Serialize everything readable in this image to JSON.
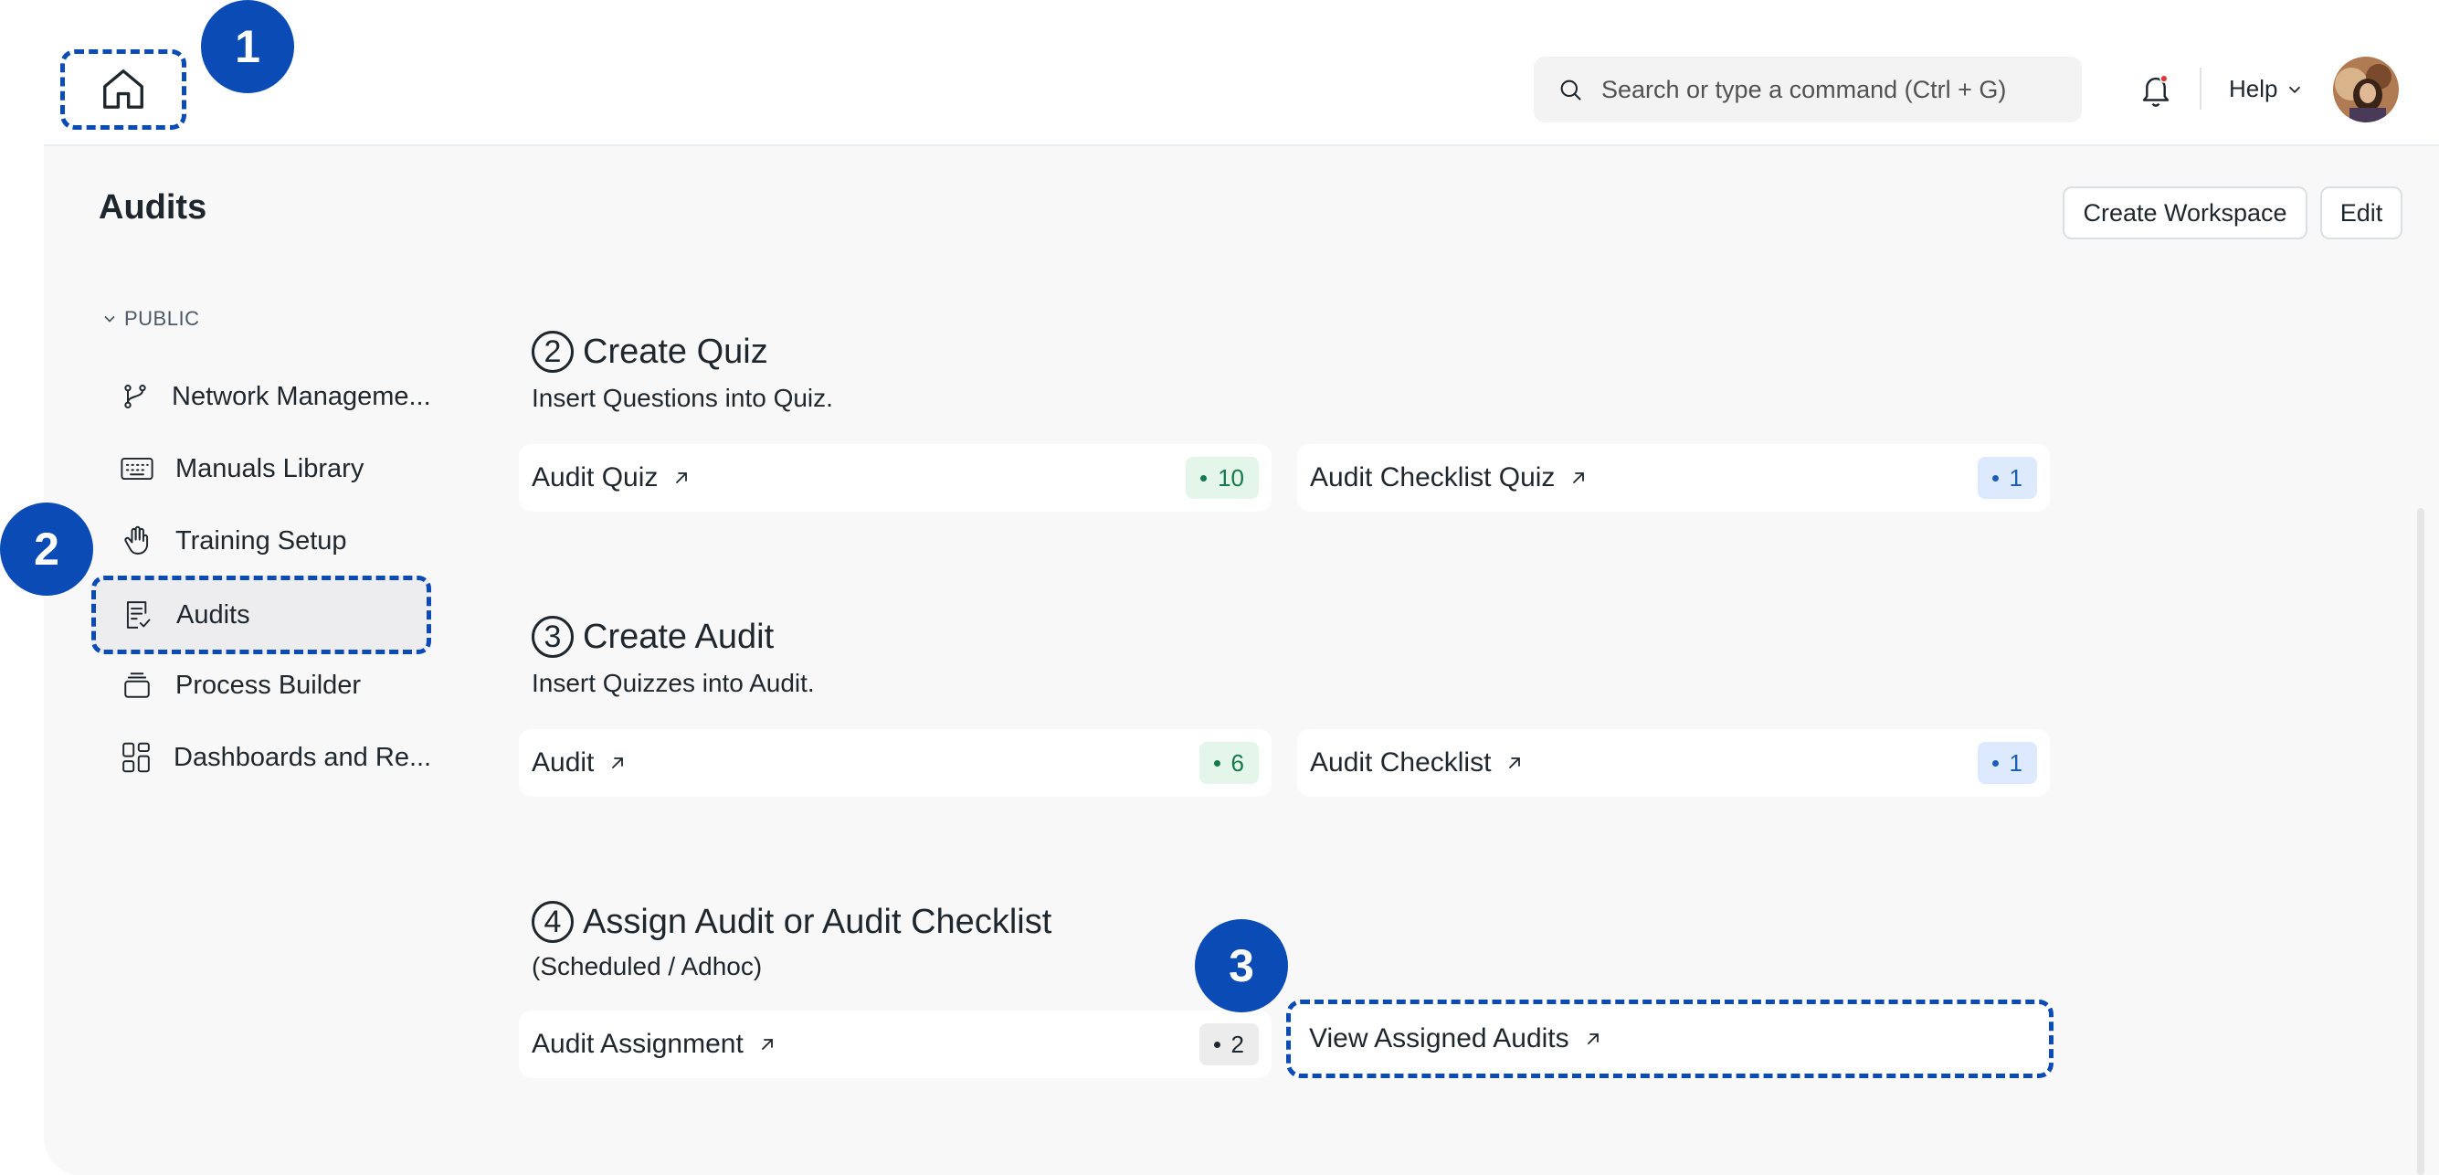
{
  "header": {
    "search_placeholder": "Search or type a command (Ctrl + G)",
    "help_label": "Help"
  },
  "callouts": [
    "1",
    "2",
    "3"
  ],
  "page": {
    "title": "Audits",
    "create_workspace_label": "Create Workspace",
    "edit_label": "Edit"
  },
  "sidebar": {
    "section_label": "PUBLIC",
    "items": [
      {
        "label": "Network Manageme...",
        "icon": "git-branch-icon"
      },
      {
        "label": "Manuals Library",
        "icon": "keyboard-icon"
      },
      {
        "label": "Training Setup",
        "icon": "hand-icon"
      },
      {
        "label": "Audits",
        "icon": "file-check-icon"
      },
      {
        "label": "Process Builder",
        "icon": "stack-icon"
      },
      {
        "label": "Dashboards and Re...",
        "icon": "grid-icon"
      }
    ]
  },
  "sections": [
    {
      "number": "2",
      "title": "Create Quiz",
      "subtitle": "Insert Questions into Quiz.",
      "cards": [
        {
          "label": "Audit Quiz",
          "count": "10"
        },
        {
          "label": "Audit Checklist Quiz",
          "count": "1"
        }
      ]
    },
    {
      "number": "3",
      "title": "Create Audit",
      "subtitle": "Insert Quizzes into Audit.",
      "cards": [
        {
          "label": "Audit",
          "count": "6"
        },
        {
          "label": "Audit Checklist",
          "count": "1"
        }
      ]
    },
    {
      "number": "4",
      "title": "Assign Audit or Audit Checklist",
      "subtitle": "(Scheduled / Adhoc)",
      "cards": [
        {
          "label": "Audit Assignment",
          "count": "2"
        },
        {
          "label": "View Assigned Audits",
          "count": ""
        }
      ]
    }
  ]
}
